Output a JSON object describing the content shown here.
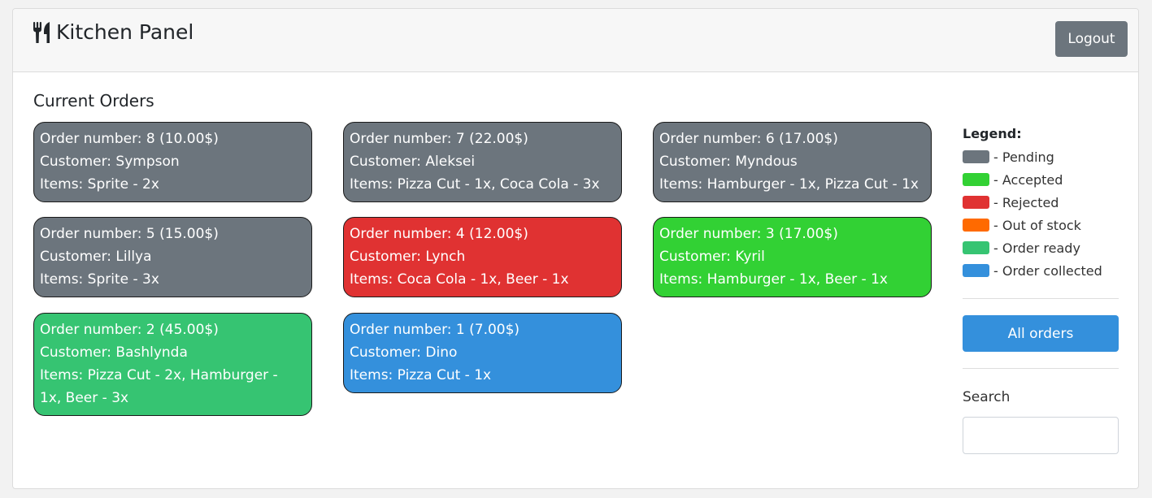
{
  "header": {
    "title": "Kitchen Panel",
    "icon": "utensils-icon",
    "logout_label": "Logout"
  },
  "main": {
    "section_title": "Current Orders",
    "orders": [
      {
        "status": "pending",
        "number_line": "Order number: 8 (10.00$)",
        "customer_line": "Customer: Sympson",
        "items_line": "Items: Sprite - 2x"
      },
      {
        "status": "pending",
        "number_line": "Order number: 7 (22.00$)",
        "customer_line": "Customer: Aleksei",
        "items_line": "Items: Pizza Cut - 1x, Coca Cola - 3x"
      },
      {
        "status": "pending",
        "number_line": "Order number: 6 (17.00$)",
        "customer_line": "Customer: Myndous",
        "items_line": "Items: Hamburger - 1x, Pizza Cut - 1x"
      },
      {
        "status": "pending",
        "number_line": "Order number: 5 (15.00$)",
        "customer_line": "Customer: Lillya",
        "items_line": "Items: Sprite - 3x"
      },
      {
        "status": "rejected",
        "number_line": "Order number: 4 (12.00$)",
        "customer_line": "Customer: Lynch",
        "items_line": "Items: Coca Cola - 1x, Beer - 1x"
      },
      {
        "status": "accepted",
        "number_line": "Order number: 3 (17.00$)",
        "customer_line": "Customer: Kyril",
        "items_line": "Items: Hamburger - 1x, Beer - 1x"
      },
      {
        "status": "ready",
        "number_line": "Order number: 2 (45.00$)",
        "customer_line": "Customer: Bashlynda",
        "items_line": "Items: Pizza Cut - 2x, Hamburger - 1x, Beer - 3x"
      },
      {
        "status": "collected",
        "number_line": "Order number: 1 (7.00$)",
        "customer_line": "Customer: Dino",
        "items_line": "Items: Pizza Cut - 1x"
      }
    ]
  },
  "sidebar": {
    "legend_title": "Legend:",
    "legend": [
      {
        "label": "- Pending",
        "color": "#6c757d"
      },
      {
        "label": "- Accepted",
        "color": "#32d134"
      },
      {
        "label": "- Rejected",
        "color": "#e03232"
      },
      {
        "label": "- Out of stock",
        "color": "#ff6a00"
      },
      {
        "label": "- Order ready",
        "color": "#36c472"
      },
      {
        "label": "- Order collected",
        "color": "#3490dc"
      }
    ],
    "all_orders_label": "All orders",
    "search_label": "Search",
    "search_value": "",
    "search_placeholder": ""
  },
  "colors": {
    "pending": "#6c757d",
    "accepted": "#32d134",
    "rejected": "#e03232",
    "out_of_stock": "#ff6a00",
    "order_ready": "#36c472",
    "order_collected": "#3490dc"
  }
}
